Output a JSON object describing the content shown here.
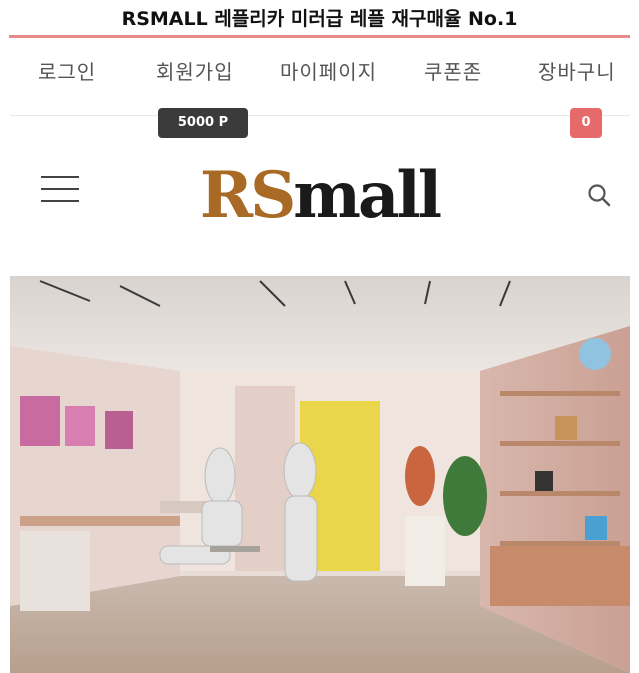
{
  "banner": {
    "title": "RSMALL 레플리카 미러급 레플 재구매율 No.1"
  },
  "nav": {
    "login": "로그인",
    "signup": "회원가입",
    "mypage": "마이페이지",
    "coupon": "쿠폰존",
    "cart": "장바구니",
    "points_badge": "5000 P",
    "cart_count": "0"
  },
  "header": {
    "logo_rs": "RS",
    "logo_mall": "mall",
    "menu_icon": "hamburger-icon",
    "search_icon": "search-icon"
  },
  "hero": {
    "image": "store-interior-photo"
  },
  "colors": {
    "accent_line": "#e68a8a",
    "logo_brown": "#a86a24",
    "cart_badge": "#e66a6a",
    "points_badge": "#3b3b3b"
  }
}
